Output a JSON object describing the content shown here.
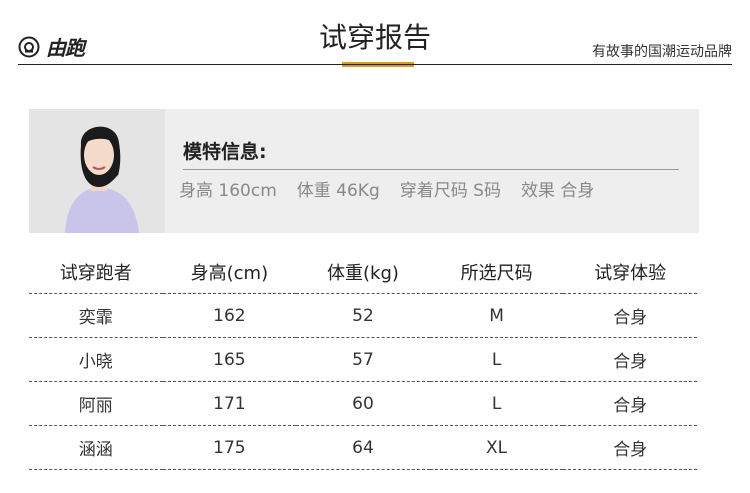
{
  "header": {
    "logo_text": "由跑",
    "title": "试穿报告",
    "slogan": "有故事的国潮运动品牌",
    "accent_color": "#d4a017"
  },
  "model": {
    "section_title": "模特信息:",
    "height": "身高 160cm",
    "weight": "体重  46Kg",
    "size": "穿着尺码   S码",
    "effect": "效果 合身"
  },
  "table": {
    "headers": [
      "试穿跑者",
      "身高(cm)",
      "体重(kg)",
      "所选尺码",
      "试穿体验"
    ],
    "rows": [
      [
        "奕霏",
        "162",
        "52",
        "M",
        "合身"
      ],
      [
        "小晓",
        "165",
        "57",
        "L",
        "合身"
      ],
      [
        "阿丽",
        "171",
        "60",
        "L",
        "合身"
      ],
      [
        "涵涵",
        "175",
        "64",
        "XL",
        "合身"
      ]
    ]
  }
}
